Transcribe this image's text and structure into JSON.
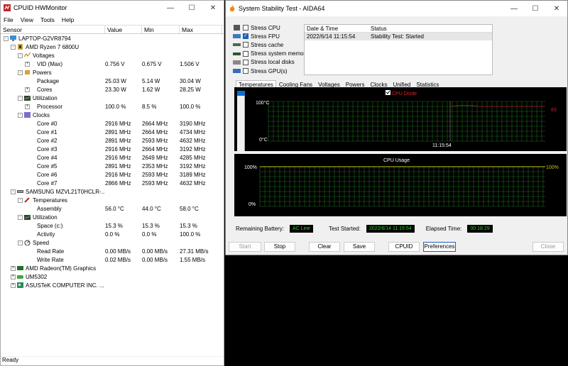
{
  "hwmonitor": {
    "title": "CPUID HWMonitor",
    "menu": [
      "File",
      "View",
      "Tools",
      "Help"
    ],
    "columns": [
      "Sensor",
      "Value",
      "Min",
      "Max"
    ],
    "status": "Ready",
    "rows": [
      {
        "lvl": 0,
        "exp": "-",
        "icon": "computer-icon",
        "name": "LAPTOP-G2VR8794",
        "v": "",
        "mn": "",
        "mx": ""
      },
      {
        "lvl": 1,
        "exp": "-",
        "icon": "cpu-icon",
        "name": "AMD Ryzen 7 6800U",
        "v": "",
        "mn": "",
        "mx": ""
      },
      {
        "lvl": 2,
        "exp": "-",
        "icon": "voltage-icon",
        "name": "Voltages",
        "v": "",
        "mn": "",
        "mx": ""
      },
      {
        "lvl": 3,
        "exp": "+",
        "icon": "",
        "name": "VID (Max)",
        "v": "0.756 V",
        "mn": "0.675 V",
        "mx": "1.506 V"
      },
      {
        "lvl": 2,
        "exp": "-",
        "icon": "power-icon",
        "name": "Powers",
        "v": "",
        "mn": "",
        "mx": ""
      },
      {
        "lvl": 3,
        "exp": "",
        "icon": "",
        "name": "Package",
        "v": "25.03 W",
        "mn": "5.14 W",
        "mx": "30.04 W"
      },
      {
        "lvl": 3,
        "exp": "+",
        "icon": "",
        "name": "Cores",
        "v": "23.30 W",
        "mn": "1.62 W",
        "mx": "28.25 W"
      },
      {
        "lvl": 2,
        "exp": "-",
        "icon": "utilization-icon",
        "name": "Utilization",
        "v": "",
        "mn": "",
        "mx": ""
      },
      {
        "lvl": 3,
        "exp": "+",
        "icon": "",
        "name": "Processor",
        "v": "100.0 %",
        "mn": "8.5 %",
        "mx": "100.0 %"
      },
      {
        "lvl": 2,
        "exp": "-",
        "icon": "clock-icon",
        "name": "Clocks",
        "v": "",
        "mn": "",
        "mx": ""
      },
      {
        "lvl": 3,
        "exp": "",
        "icon": "",
        "name": "Core #0",
        "v": "2916 MHz",
        "mn": "2664 MHz",
        "mx": "3190 MHz"
      },
      {
        "lvl": 3,
        "exp": "",
        "icon": "",
        "name": "Core #1",
        "v": "2891 MHz",
        "mn": "2664 MHz",
        "mx": "4734 MHz"
      },
      {
        "lvl": 3,
        "exp": "",
        "icon": "",
        "name": "Core #2",
        "v": "2891 MHz",
        "mn": "2593 MHz",
        "mx": "4632 MHz"
      },
      {
        "lvl": 3,
        "exp": "",
        "icon": "",
        "name": "Core #3",
        "v": "2916 MHz",
        "mn": "2664 MHz",
        "mx": "3192 MHz"
      },
      {
        "lvl": 3,
        "exp": "",
        "icon": "",
        "name": "Core #4",
        "v": "2916 MHz",
        "mn": "2649 MHz",
        "mx": "4285 MHz"
      },
      {
        "lvl": 3,
        "exp": "",
        "icon": "",
        "name": "Core #5",
        "v": "2891 MHz",
        "mn": "2353 MHz",
        "mx": "3192 MHz"
      },
      {
        "lvl": 3,
        "exp": "",
        "icon": "",
        "name": "Core #6",
        "v": "2916 MHz",
        "mn": "2593 MHz",
        "mx": "3189 MHz"
      },
      {
        "lvl": 3,
        "exp": "",
        "icon": "",
        "name": "Core #7",
        "v": "2866 MHz",
        "mn": "2593 MHz",
        "mx": "4632 MHz"
      },
      {
        "lvl": 1,
        "exp": "-",
        "icon": "drive-icon",
        "name": "SAMSUNG MZVL21T0HCLR-...",
        "v": "",
        "mn": "",
        "mx": ""
      },
      {
        "lvl": 2,
        "exp": "-",
        "icon": "temperature-icon",
        "name": "Temperatures",
        "v": "",
        "mn": "",
        "mx": ""
      },
      {
        "lvl": 3,
        "exp": "",
        "icon": "",
        "name": "Assembly",
        "v": "56.0 °C",
        "mn": "44.0 °C",
        "mx": "58.0 °C"
      },
      {
        "lvl": 2,
        "exp": "-",
        "icon": "utilization-icon",
        "name": "Utilization",
        "v": "",
        "mn": "",
        "mx": ""
      },
      {
        "lvl": 3,
        "exp": "",
        "icon": "",
        "name": "Space (c:)",
        "v": "15.3 %",
        "mn": "15.3 %",
        "mx": "15.3 %"
      },
      {
        "lvl": 3,
        "exp": "",
        "icon": "",
        "name": "Activity",
        "v": "0.0 %",
        "mn": "0.0 %",
        "mx": "100.0 %"
      },
      {
        "lvl": 2,
        "exp": "-",
        "icon": "speed-icon",
        "name": "Speed",
        "v": "",
        "mn": "",
        "mx": ""
      },
      {
        "lvl": 3,
        "exp": "",
        "icon": "",
        "name": "Read Rate",
        "v": "0.00 MB/s",
        "mn": "0.00 MB/s",
        "mx": "27.31 MB/s"
      },
      {
        "lvl": 3,
        "exp": "",
        "icon": "",
        "name": "Write Rate",
        "v": "0.02 MB/s",
        "mn": "0.00 MB/s",
        "mx": "1.55 MB/s"
      },
      {
        "lvl": 1,
        "exp": "+",
        "icon": "gpu-icon",
        "name": "AMD Radeon(TM) Graphics",
        "v": "",
        "mn": "",
        "mx": ""
      },
      {
        "lvl": 1,
        "exp": "+",
        "icon": "battery-icon",
        "name": "UM5302",
        "v": "",
        "mn": "",
        "mx": ""
      },
      {
        "lvl": 1,
        "exp": "+",
        "icon": "board-icon",
        "name": "ASUSTeK COMPUTER INC. ...",
        "v": "",
        "mn": "",
        "mx": ""
      }
    ]
  },
  "aida": {
    "title": "System Stability Test - AIDA64",
    "stress": [
      {
        "label": "Stress CPU",
        "checked": false,
        "icon": "cpu-chip-icon"
      },
      {
        "label": "Stress FPU",
        "checked": true,
        "icon": "fpu-icon"
      },
      {
        "label": "Stress cache",
        "checked": false,
        "icon": "cache-icon"
      },
      {
        "label": "Stress system memory",
        "checked": false,
        "icon": "memory-icon"
      },
      {
        "label": "Stress local disks",
        "checked": false,
        "icon": "disk-icon"
      },
      {
        "label": "Stress GPU(s)",
        "checked": false,
        "icon": "gpu-card-icon"
      }
    ],
    "log": {
      "col_date": "Date & Time",
      "col_status": "Status",
      "date": "2022/6/14 11:15:54",
      "status": "Stability Test: Started"
    },
    "tabs": [
      "Temperatures",
      "Cooling Fans",
      "Voltages",
      "Powers",
      "Clocks",
      "Unified",
      "Statistics"
    ],
    "temp_chart": {
      "legend": "CPU Diode",
      "y_top": "100°C",
      "y_bottom": "0°C",
      "time": "11:15:54",
      "value_label": "83"
    },
    "usage_chart": {
      "title": "CPU Usage",
      "y_top": "100%",
      "y_bottom": "0%",
      "value_label": "100%"
    },
    "info": {
      "battery_label": "Remaining Battery:",
      "battery_value": "AC Line",
      "started_label": "Test Started:",
      "started_value": "2022/6/14 11:15:54",
      "elapsed_label": "Elapsed Time:",
      "elapsed_value": "00:18:29"
    },
    "buttons": {
      "start": "Start",
      "stop": "Stop",
      "clear": "Clear",
      "save": "Save",
      "cpuid": "CPUID",
      "preferences": "Preferences",
      "close": "Close"
    },
    "colors": {
      "grid": "#1e6b1e",
      "trace_temp": "#7a2020",
      "trace_usage": "#c8c800",
      "legend_text": "#e02020",
      "info_green": "#2fd02f"
    }
  }
}
